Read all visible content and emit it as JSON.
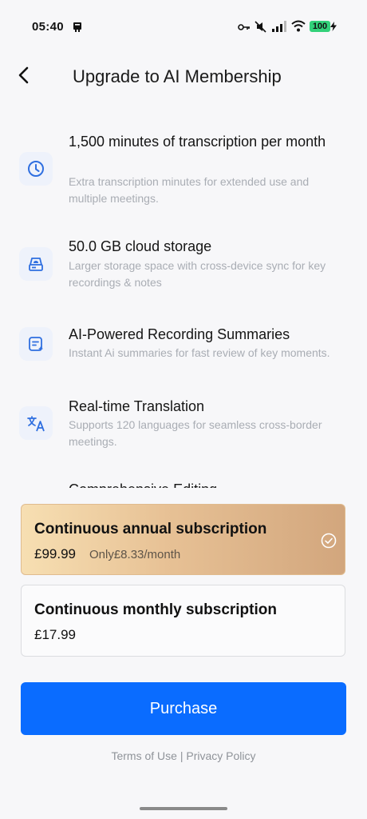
{
  "status_bar": {
    "time": "05:40",
    "battery": "100"
  },
  "header": {
    "title": "Upgrade to AI Membership"
  },
  "features": [
    {
      "icon": "clock-icon",
      "title": "1,500 minutes of transcription per month",
      "description": "Extra transcription minutes for extended use and multiple meetings."
    },
    {
      "icon": "cloud-storage-icon",
      "title": "50.0 GB cloud storage",
      "description": "Larger storage space with cross-device sync for key recordings & notes"
    },
    {
      "icon": "ai-summary-icon",
      "title": "AI-Powered Recording Summaries",
      "description": "Instant Ai summaries for fast review of key moments."
    },
    {
      "icon": "translate-icon",
      "title": "Real-time Translation",
      "description": "Supports 120 languages for seamless cross-border meetings."
    },
    {
      "title": "Comprehensive Editing"
    }
  ],
  "plans": {
    "annual": {
      "name": "Continuous annual subscription",
      "price": "£99.99",
      "per_month": "Only£8.33/month",
      "selected": true
    },
    "monthly": {
      "name": "Continuous monthly subscription",
      "price": "£17.99",
      "selected": false
    }
  },
  "purchase_label": "Purchase",
  "footer": {
    "terms": "Terms of Use",
    "separator": "|",
    "privacy": "Privacy Policy"
  },
  "colors": {
    "accent": "#0a6cff",
    "icon_blue": "#2f6fe0"
  }
}
